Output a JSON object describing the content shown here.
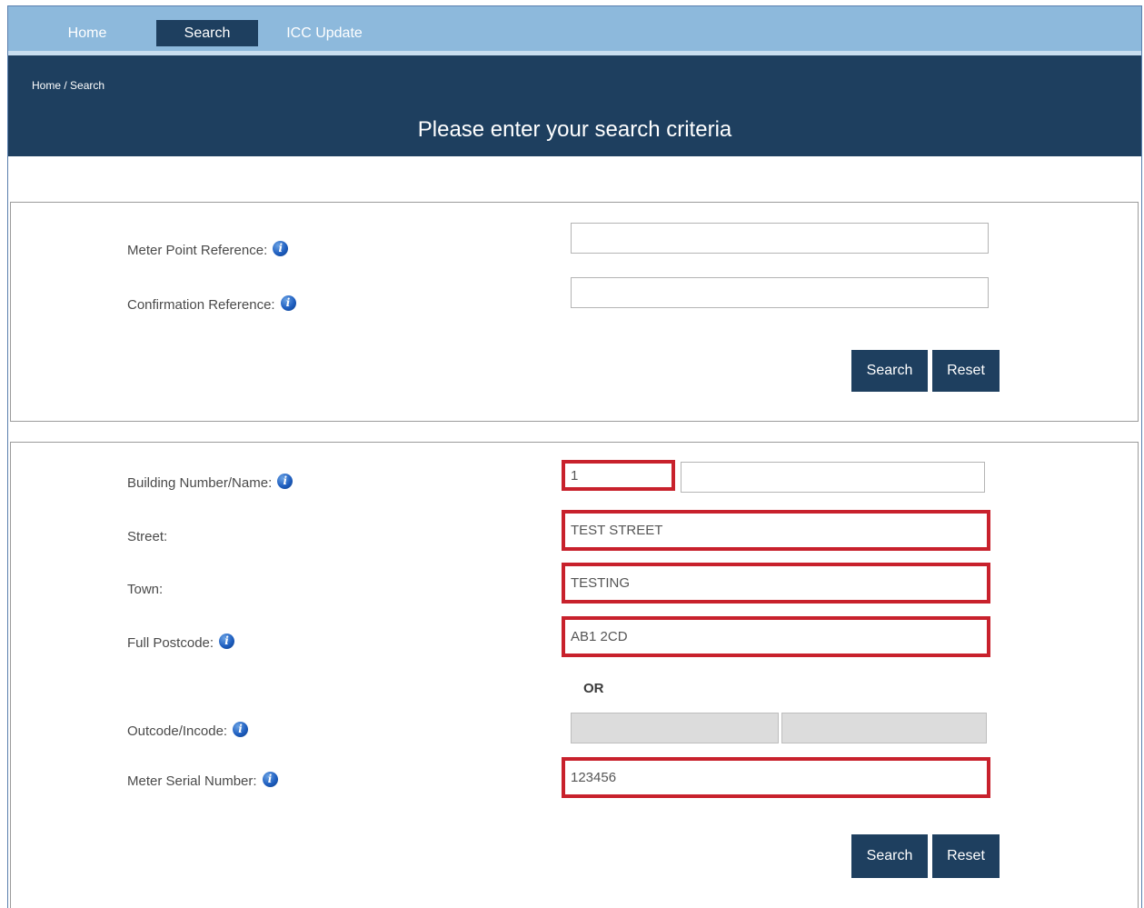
{
  "nav": {
    "items": [
      {
        "label": "Home"
      },
      {
        "label": "Search"
      },
      {
        "label": "ICC Update"
      }
    ]
  },
  "breadcrumb": "Home / Search",
  "page_title": "Please enter your search criteria",
  "reference_panel": {
    "meter_point_label": "Meter Point Reference:",
    "meter_point_value": "",
    "confirmation_label": "Confirmation Reference:",
    "confirmation_value": "",
    "search_label": "Search",
    "reset_label": "Reset"
  },
  "address_panel": {
    "building_label": "Building Number/Name:",
    "building_number_value": "1",
    "building_name_value": "",
    "street_label": "Street:",
    "street_value": "TEST STREET",
    "town_label": "Town:",
    "town_value": "TESTING",
    "postcode_label": "Full Postcode:",
    "postcode_value": "AB1 2CD",
    "or_label": "OR",
    "outcode_label": "Outcode/Incode:",
    "outcode_value": "",
    "incode_value": "",
    "meter_serial_label": "Meter Serial Number:",
    "meter_serial_value": "123456",
    "search_label": "Search",
    "reset_label": "Reset"
  },
  "colors": {
    "nav_bg": "#8db9dc",
    "header_bg": "#1e3f5f",
    "button_bg": "#1e3f5f",
    "highlight": "#c8212c",
    "disabled_input": "#dcdcdc"
  },
  "icons": {
    "info": "info-icon"
  }
}
